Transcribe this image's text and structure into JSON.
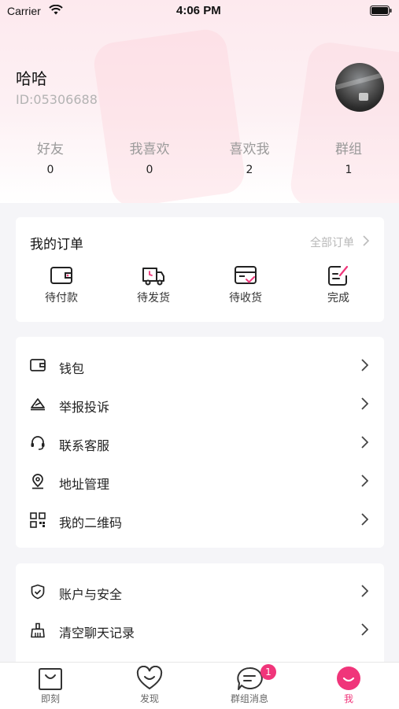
{
  "status_bar": {
    "carrier": "Carrier",
    "time": "4:06 PM"
  },
  "profile": {
    "name": "哈哈",
    "id": "ID:05306688"
  },
  "stats": [
    {
      "label": "好友",
      "value": "0"
    },
    {
      "label": "我喜欢",
      "value": "0"
    },
    {
      "label": "喜欢我",
      "value": "2"
    },
    {
      "label": "群组",
      "value": "1"
    }
  ],
  "orders": {
    "title": "我的订单",
    "all_label": "全部订单",
    "items": [
      {
        "label": "待付款",
        "icon": "wallet-icon"
      },
      {
        "label": "待发货",
        "icon": "delivery-truck-icon"
      },
      {
        "label": "待收货",
        "icon": "receive-box-icon"
      },
      {
        "label": "完成",
        "icon": "edit-done-icon"
      }
    ]
  },
  "menu_primary": [
    {
      "label": "钱包",
      "icon": "wallet-icon"
    },
    {
      "label": "举报投诉",
      "icon": "report-icon"
    },
    {
      "label": "联系客服",
      "icon": "headset-icon"
    },
    {
      "label": "地址管理",
      "icon": "location-pin-icon"
    },
    {
      "label": "我的二维码",
      "icon": "qr-code-icon"
    }
  ],
  "menu_secondary": [
    {
      "label": "账户与安全",
      "icon": "shield-check-icon"
    },
    {
      "label": "清空聊天记录",
      "icon": "broom-icon"
    }
  ],
  "tabbar": {
    "tabs": [
      {
        "label": "即刻",
        "icon": "bag-icon"
      },
      {
        "label": "发现",
        "icon": "heart-icon"
      },
      {
        "label": "群组消息",
        "icon": "chat-bubble-icon"
      },
      {
        "label": "我",
        "icon": "smile-face-icon"
      }
    ],
    "badge_count": "1",
    "active_color": "#f0357a"
  },
  "colors": {
    "accent": "#f0357a",
    "background": "#f5f5f8"
  }
}
